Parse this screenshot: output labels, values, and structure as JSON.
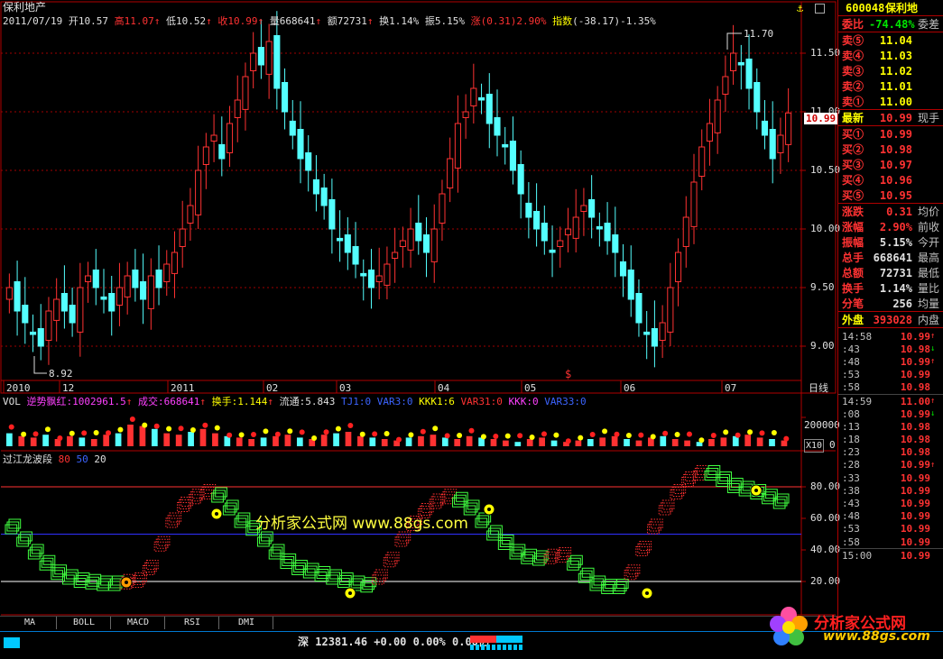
{
  "header": {
    "stock_name": "保利地产",
    "date": "2011/07/19",
    "open_label": "开",
    "open": "10.57",
    "high_label": "高",
    "high": "11.07",
    "low_label": "低",
    "low": "10.52",
    "close_label": "收",
    "close": "10.99",
    "vol_label": "量",
    "vol": "668641",
    "amt_label": "额",
    "amt": "72731",
    "turn_label": "换",
    "turn": "1.14%",
    "amp_label": "振",
    "amp": "5.15%",
    "chg_label": "涨",
    "chg": "(0.31)2.90%",
    "idx_label": "指数",
    "idx": "(-38.17)-1.35%"
  },
  "price_axis": [
    "11.50",
    "11.00",
    "10.50",
    "10.00",
    "9.50",
    "9.00"
  ],
  "price_marker": "10.99",
  "annotations": {
    "high_mark": "11.70",
    "low_mark": "8.92"
  },
  "date_axis": [
    "2010",
    "12",
    "2011",
    "02",
    "03",
    "04",
    "05",
    "06",
    "07"
  ],
  "period_label": "日线",
  "vol_header": {
    "name": "VOL",
    "s1": "逆势飘红:1002961.5",
    "s2": "成交:668641",
    "s3": "换手:1.144",
    "s4": "流通:5.843",
    "s5": "TJ1:0",
    "s6": "VAR3:0",
    "s7": "KKK1:6",
    "s8": "VAR31:0",
    "s9": "KKK:0",
    "s10": "VAR33:0"
  },
  "vol_axis": {
    "top": "200000",
    "unit": "X10",
    "zero": "0"
  },
  "indicator": {
    "name": "过江龙波段",
    "p1": "80",
    "p2": "50",
    "p3": "20"
  },
  "ind_axis": [
    "80.00",
    "60.00",
    "40.00",
    "20.00"
  ],
  "watermark": "分析家公式网 www.88gs.com",
  "tabs": [
    "MA",
    "BOLL",
    "MACD",
    "RSI",
    "DMI"
  ],
  "status": {
    "market": "深",
    "index": "12381.46",
    "chg": "+0.00",
    "pct": "0.00%",
    "amt": "0.00亿"
  },
  "logo": {
    "brand": "分析家公式网",
    "url": "www.88gs.com"
  },
  "quote": {
    "code": "600048",
    "name": "保利地",
    "wb_label": "委比",
    "wb": "-74.48%",
    "wc_label": "委差",
    "asks": [
      {
        "l": "卖⑤",
        "p": "11.04"
      },
      {
        "l": "卖④",
        "p": "11.03"
      },
      {
        "l": "卖③",
        "p": "11.02"
      },
      {
        "l": "卖②",
        "p": "11.01"
      },
      {
        "l": "卖①",
        "p": "11.00"
      }
    ],
    "last_label": "最新",
    "last": "10.99",
    "last_ex": "现手",
    "bids": [
      {
        "l": "买①",
        "p": "10.99"
      },
      {
        "l": "买②",
        "p": "10.98"
      },
      {
        "l": "买③",
        "p": "10.97"
      },
      {
        "l": "买④",
        "p": "10.96"
      },
      {
        "l": "买⑤",
        "p": "10.95"
      }
    ],
    "stats": [
      {
        "l": "涨跌",
        "v": "0.31",
        "e": "均价",
        "c": "red"
      },
      {
        "l": "涨幅",
        "v": "2.90%",
        "e": "前收",
        "c": "red"
      },
      {
        "l": "振幅",
        "v": "5.15%",
        "e": "今开",
        "c": "wht"
      },
      {
        "l": "总手",
        "v": "668641",
        "e": "最高",
        "c": "wht"
      },
      {
        "l": "总额",
        "v": "72731",
        "e": "最低",
        "c": "wht"
      },
      {
        "l": "换手",
        "v": "1.14%",
        "e": "量比",
        "c": "wht"
      },
      {
        "l": "分笔",
        "v": "256",
        "e": "均量",
        "c": "wht"
      }
    ],
    "outer_label": "外盘",
    "outer": "393028",
    "inner_label": "内盘",
    "ticks": [
      {
        "t": "14:58",
        "p": "10.99",
        "a": "↑"
      },
      {
        "t": ":43",
        "p": "10.98",
        "a": "↓"
      },
      {
        "t": ":48",
        "p": "10.99",
        "a": "↑"
      },
      {
        "t": ":53",
        "p": "10.99",
        "a": ""
      },
      {
        "t": ":58",
        "p": "10.98",
        "a": ""
      },
      {
        "t": "14:59",
        "p": "11.00",
        "a": "↑"
      },
      {
        "t": ":08",
        "p": "10.99",
        "a": "↓"
      },
      {
        "t": ":13",
        "p": "10.98",
        "a": ""
      },
      {
        "t": ":18",
        "p": "10.98",
        "a": ""
      },
      {
        "t": ":23",
        "p": "10.98",
        "a": ""
      },
      {
        "t": ":28",
        "p": "10.99",
        "a": "↑"
      },
      {
        "t": ":33",
        "p": "10.99",
        "a": ""
      },
      {
        "t": ":38",
        "p": "10.99",
        "a": ""
      },
      {
        "t": ":43",
        "p": "10.99",
        "a": ""
      },
      {
        "t": ":48",
        "p": "10.99",
        "a": ""
      },
      {
        "t": ":53",
        "p": "10.99",
        "a": ""
      },
      {
        "t": ":58",
        "p": "10.99",
        "a": ""
      },
      {
        "t": "15:00",
        "p": "10.99",
        "a": ""
      }
    ]
  },
  "chart_data": [
    {
      "type": "candlestick",
      "title": "保利地产",
      "ylim": [
        8.8,
        11.8
      ],
      "x_ticks": [
        "2010",
        "12",
        "2011",
        "02",
        "03",
        "04",
        "05",
        "06",
        "07"
      ],
      "close_approx": [
        9.5,
        9.3,
        9.2,
        9.1,
        9.0,
        9.3,
        9.4,
        9.3,
        9.2,
        9.5,
        9.6,
        9.5,
        9.4,
        9.3,
        9.5,
        9.6,
        9.5,
        9.4,
        9.6,
        9.5,
        9.7,
        9.8,
        10.0,
        10.2,
        10.5,
        10.7,
        10.8,
        10.6,
        10.9,
        11.1,
        11.3,
        11.5,
        11.4,
        11.6,
        11.2,
        11.0,
        10.8,
        10.6,
        10.5,
        10.3,
        10.2,
        10.0,
        9.9,
        9.8,
        9.7,
        9.6,
        9.5,
        9.6,
        9.7,
        9.8,
        9.9,
        10.0,
        9.9,
        9.8,
        10.0,
        10.3,
        10.6,
        10.9,
        11.0,
        11.2,
        11.1,
        10.9,
        10.8,
        10.7,
        10.5,
        10.3,
        10.1,
        10.0,
        9.9,
        9.8,
        9.9,
        10.0,
        10.1,
        10.2,
        10.1,
        10.0,
        9.9,
        9.8,
        9.6,
        9.4,
        9.2,
        9.1,
        9.0,
        9.2,
        9.5,
        9.8,
        10.1,
        10.4,
        10.7,
        10.9,
        11.1,
        11.3,
        11.5,
        11.4,
        11.2,
        11.0,
        10.8,
        10.6,
        10.8,
        10.99
      ],
      "max": 11.7,
      "min": 8.92
    },
    {
      "type": "bar",
      "name": "VOL",
      "ylim": [
        0,
        250000
      ],
      "values": [
        90000,
        70000,
        60000,
        80000,
        50000,
        70000,
        60000,
        50000,
        80000,
        90000,
        150000,
        140000,
        120000,
        90000,
        80000,
        100000,
        120000,
        90000,
        70000,
        60000,
        50000,
        60000,
        70000,
        80000,
        60000,
        50000,
        80000,
        90000,
        100000,
        70000,
        60000,
        50000,
        40000,
        60000,
        70000,
        80000,
        60000,
        50000,
        70000,
        60000,
        50000,
        40000,
        30000,
        50000,
        60000,
        40000,
        30000,
        40000,
        50000,
        60000,
        70000,
        50000,
        40000,
        60000,
        70000,
        50000,
        40000,
        30000,
        50000,
        60000,
        70000,
        80000,
        60000,
        50000,
        40000
      ]
    },
    {
      "type": "line",
      "name": "过江龙波段",
      "ylim": [
        0,
        100
      ],
      "hlines": [
        80,
        50,
        20
      ],
      "values": [
        56,
        48,
        40,
        33,
        27,
        24,
        22,
        21,
        20,
        20,
        21,
        22,
        30,
        45,
        60,
        70,
        75,
        78,
        76,
        68,
        60,
        55,
        48,
        40,
        34,
        30,
        28,
        26,
        24,
        22,
        20,
        19,
        24,
        35,
        48,
        58,
        66,
        72,
        75,
        73,
        68,
        60,
        52,
        46,
        40,
        37,
        36,
        37,
        38,
        33,
        25,
        20,
        18,
        18,
        27,
        42,
        56,
        68,
        78,
        86,
        90,
        90,
        86,
        82,
        80,
        78,
        75,
        72
      ]
    }
  ]
}
